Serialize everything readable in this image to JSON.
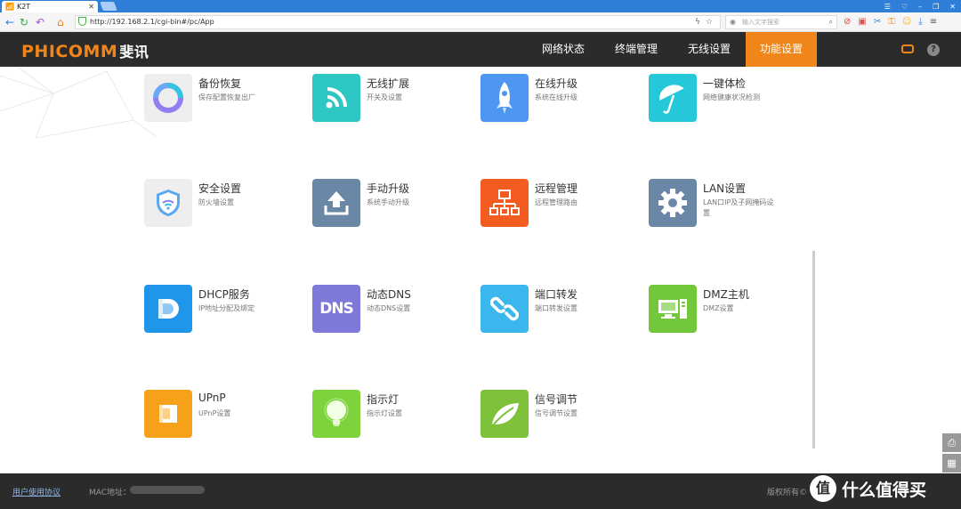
{
  "browser": {
    "tab_title": "K2T",
    "url": "http://192.168.2.1/cgi-bin#/pc/App",
    "search_placeholder": "输入文字搜索"
  },
  "app": {
    "brand": "PHICOMM",
    "brand_cn": "斐讯",
    "nav": [
      "网络状态",
      "终端管理",
      "无线设置",
      "功能设置"
    ],
    "active_nav": "功能设置",
    "help": "?"
  },
  "items": [
    {
      "title": "备份恢复",
      "sub": "保存配置恢复出厂",
      "icon": "backup-icon",
      "color": "#eeeeee"
    },
    {
      "title": "无线扩展",
      "sub": "开关及设置",
      "icon": "wifi-extend-icon",
      "color": "#2ec7c3"
    },
    {
      "title": "在线升级",
      "sub": "系统在线升级",
      "icon": "rocket-icon",
      "color": "#4d96f2"
    },
    {
      "title": "一键体检",
      "sub": "网络健康状况检测",
      "icon": "umbrella-icon",
      "color": "#25c8d8"
    },
    {
      "title": "安全设置",
      "sub": "防火墙设置",
      "icon": "shield-icon",
      "color": "#eeeeee"
    },
    {
      "title": "手动升级",
      "sub": "系统手动升级",
      "icon": "upload-icon",
      "color": "#6b87a6"
    },
    {
      "title": "远程管理",
      "sub": "远程管理路由",
      "icon": "network-icon",
      "color": "#f25c21"
    },
    {
      "title": "LAN设置",
      "sub": "LAN口IP及子网掩码设置",
      "icon": "gear-icon",
      "color": "#6b87a6"
    },
    {
      "title": "DHCP服务",
      "sub": "IP地址分配及绑定",
      "icon": "dhcp-icon",
      "color": "#1f96ea"
    },
    {
      "title": "动态DNS",
      "sub": "动态DNS设置",
      "icon": "dns-icon",
      "color": "#7f79d9"
    },
    {
      "title": "端口转发",
      "sub": "端口转发设置",
      "icon": "link-icon",
      "color": "#3cb7ee"
    },
    {
      "title": "DMZ主机",
      "sub": "DMZ设置",
      "icon": "computer-icon",
      "color": "#72c73a"
    },
    {
      "title": "UPnP",
      "sub": "UPnP设置",
      "icon": "upnp-icon",
      "color": "#f7a11a"
    },
    {
      "title": "指示灯",
      "sub": "指示灯设置",
      "icon": "bulb-icon",
      "color": "#7ed33d"
    },
    {
      "title": "信号调节",
      "sub": "信号调节设置",
      "icon": "leaf-icon",
      "color": "#7ec23c"
    }
  ],
  "footer": {
    "agreement": "用户使用协议",
    "mac_label": "MAC地址：",
    "rights": "版权所有©",
    "watermark_symbol": "值",
    "watermark": "什么值得买"
  }
}
